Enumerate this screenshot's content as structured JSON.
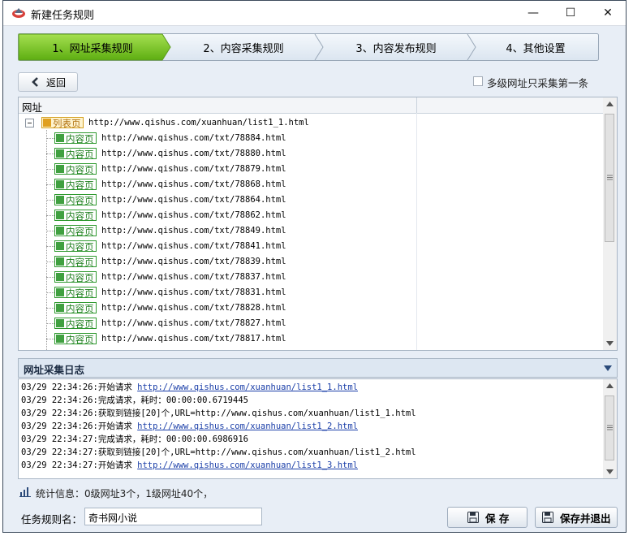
{
  "window": {
    "title": "新建任务规则",
    "controls": {
      "minimize": "—",
      "maximize": "☐",
      "close": "✕"
    }
  },
  "steps": [
    {
      "label": "1、网址采集规则",
      "active": true
    },
    {
      "label": "2、内容采集规则",
      "active": false
    },
    {
      "label": "3、内容发布规则",
      "active": false
    },
    {
      "label": "4、其他设置",
      "active": false
    }
  ],
  "toolbar": {
    "back_label": "返回",
    "multi_level_option": {
      "label": "多级网址只采集第一条",
      "checked": false
    }
  },
  "url_tree": {
    "column_header": "网址",
    "root": {
      "tag": "列表页",
      "url": "http://www.qishus.com/xuanhuan/list1_1.html"
    },
    "children_tag": "内容页",
    "children": [
      "http://www.qishus.com/txt/78884.html",
      "http://www.qishus.com/txt/78880.html",
      "http://www.qishus.com/txt/78879.html",
      "http://www.qishus.com/txt/78868.html",
      "http://www.qishus.com/txt/78864.html",
      "http://www.qishus.com/txt/78862.html",
      "http://www.qishus.com/txt/78849.html",
      "http://www.qishus.com/txt/78841.html",
      "http://www.qishus.com/txt/78839.html",
      "http://www.qishus.com/txt/78837.html",
      "http://www.qishus.com/txt/78831.html",
      "http://www.qishus.com/txt/78828.html",
      "http://www.qishus.com/txt/78827.html",
      "http://www.qishus.com/txt/78817.html"
    ]
  },
  "log": {
    "title": "网址采集日志",
    "lines": [
      {
        "time": "03/29 22:34:26:",
        "text": "开始请求 ",
        "link": "http://www.qishus.com/xuanhuan/list1_1.html"
      },
      {
        "time": "03/29 22:34:26:",
        "text": "完成请求，耗时：00:00:00.6719445",
        "link": ""
      },
      {
        "time": "03/29 22:34:26:",
        "text": "获取到链接[20]个,URL=http://www.qishus.com/xuanhuan/list1_1.html",
        "link": ""
      },
      {
        "time": "03/29 22:34:26:",
        "text": "开始请求 ",
        "link": "http://www.qishus.com/xuanhuan/list1_2.html"
      },
      {
        "time": "03/29 22:34:27:",
        "text": "完成请求，耗时：00:00:00.6986916",
        "link": ""
      },
      {
        "time": "03/29 22:34:27:",
        "text": "获取到链接[20]个,URL=http://www.qishus.com/xuanhuan/list1_2.html",
        "link": ""
      },
      {
        "time": "03/29 22:34:27:",
        "text": "开始请求 ",
        "link": "http://www.qishus.com/xuanhuan/list1_3.html"
      }
    ]
  },
  "stats": {
    "text": "统计信息：0级网址3个，1级网址40个，"
  },
  "bottom": {
    "rule_name_label": "任务规则名：",
    "rule_name_value": "奇书网小说",
    "save_label": "保 存",
    "save_exit_label": "保存并退出"
  },
  "colors": {
    "active_step": "#7cc61e",
    "inactive_step": "#e2ebf5",
    "content_tag": "#2f9a2f",
    "list_tag": "#e0a020",
    "log_link": "#1a3ea8"
  }
}
